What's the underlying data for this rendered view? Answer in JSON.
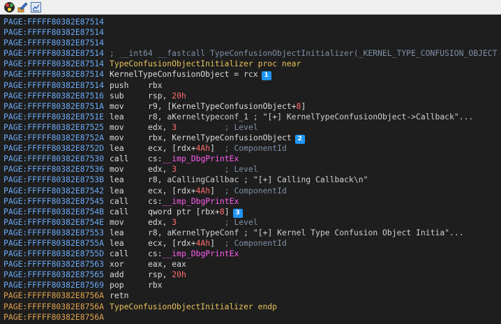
{
  "toolbar": {
    "buttons": [
      {
        "icon": "graph-view-icon",
        "label": ""
      },
      {
        "icon": "edit-icon",
        "label": ""
      },
      {
        "icon": "text-view-icon",
        "label": ""
      }
    ]
  },
  "listing": [
    {
      "address": "PAGE:FFFFF80382E87514",
      "kind": "empty"
    },
    {
      "address": "PAGE:FFFFF80382E87514",
      "kind": "empty"
    },
    {
      "address": "PAGE:FFFFF80382E87514",
      "kind": "empty"
    },
    {
      "address": "PAGE:FFFFF80382E87514",
      "kind": "comment",
      "text": "; __int64 __fastcall TypeConfusionObjectInitializer(_KERNEL_TYPE_CONFUSION_OBJECT"
    },
    {
      "address": "PAGE:FFFFF80382E87514",
      "kind": "proc",
      "text": "TypeConfusionObjectInitializer proc near"
    },
    {
      "address": "PAGE:FFFFF80382E87514",
      "kind": "assign",
      "text": "KernelTypeConfusionObject = rcx",
      "badge": "1"
    },
    {
      "address": "PAGE:FFFFF80382E87514",
      "kind": "ins",
      "mnem": "push",
      "ops": [
        {
          "t": "rbx",
          "c": "op"
        }
      ]
    },
    {
      "address": "PAGE:FFFFF80382E87516",
      "kind": "ins",
      "mnem": "sub",
      "ops": [
        {
          "t": "rsp, ",
          "c": "op"
        },
        {
          "t": "20h",
          "c": "num"
        }
      ]
    },
    {
      "address": "PAGE:FFFFF80382E8751A",
      "kind": "ins",
      "mnem": "mov",
      "ops": [
        {
          "t": "r9, [KernelTypeConfusionObject+",
          "c": "op"
        },
        {
          "t": "8",
          "c": "num"
        },
        {
          "t": "]",
          "c": "op"
        }
      ]
    },
    {
      "address": "PAGE:FFFFF80382E8751E",
      "kind": "ins",
      "mnem": "lea",
      "ops": [
        {
          "t": "r8, aKerneltypeconf_1 ; \"[+] KernelTypeConfusionObject->Callback\"...",
          "c": "str"
        }
      ]
    },
    {
      "address": "PAGE:FFFFF80382E87525",
      "kind": "ins",
      "mnem": "mov",
      "ops": [
        {
          "t": "edx, ",
          "c": "op"
        },
        {
          "t": "3",
          "c": "num"
        },
        {
          "t": "          ; Level",
          "c": "cmt"
        }
      ]
    },
    {
      "address": "PAGE:FFFFF80382E8752A",
      "kind": "ins",
      "mnem": "mov",
      "ops": [
        {
          "t": "rbx, KernelTypeConfusionObject",
          "c": "op"
        }
      ],
      "badge": "2"
    },
    {
      "address": "PAGE:FFFFF80382E8752D",
      "kind": "ins",
      "mnem": "lea",
      "ops": [
        {
          "t": "ecx, [rdx+",
          "c": "op"
        },
        {
          "t": "4Ah",
          "c": "num"
        },
        {
          "t": "]",
          "c": "op"
        },
        {
          "t": "  ; ComponentId",
          "c": "cmt"
        }
      ]
    },
    {
      "address": "PAGE:FFFFF80382E87530",
      "kind": "ins",
      "mnem": "call",
      "ops": [
        {
          "t": "cs:",
          "c": "op"
        },
        {
          "t": "__imp_DbgPrintEx",
          "c": "imp"
        }
      ]
    },
    {
      "address": "PAGE:FFFFF80382E87536",
      "kind": "ins",
      "mnem": "mov",
      "ops": [
        {
          "t": "edx, ",
          "c": "op"
        },
        {
          "t": "3",
          "c": "num"
        },
        {
          "t": "          ; Level",
          "c": "cmt"
        }
      ]
    },
    {
      "address": "PAGE:FFFFF80382E8753B",
      "kind": "ins",
      "mnem": "lea",
      "ops": [
        {
          "t": "r8, aCallingCallbac ; \"[+] Calling Callback\\n\"",
          "c": "str"
        }
      ]
    },
    {
      "address": "PAGE:FFFFF80382E87542",
      "kind": "ins",
      "mnem": "lea",
      "ops": [
        {
          "t": "ecx, [rdx+",
          "c": "op"
        },
        {
          "t": "4Ah",
          "c": "num"
        },
        {
          "t": "]",
          "c": "op"
        },
        {
          "t": "  ; ComponentId",
          "c": "cmt"
        }
      ]
    },
    {
      "address": "PAGE:FFFFF80382E87545",
      "kind": "ins",
      "mnem": "call",
      "ops": [
        {
          "t": "cs:",
          "c": "op"
        },
        {
          "t": "__imp_DbgPrintEx",
          "c": "imp"
        }
      ]
    },
    {
      "address": "PAGE:FFFFF80382E8754B",
      "kind": "ins",
      "mnem": "call",
      "ops": [
        {
          "t": "qword ptr [rbx+",
          "c": "op"
        },
        {
          "t": "8",
          "c": "num"
        },
        {
          "t": "]",
          "c": "op"
        }
      ],
      "badge": "3"
    },
    {
      "address": "PAGE:FFFFF80382E8754E",
      "kind": "ins",
      "mnem": "mov",
      "ops": [
        {
          "t": "edx, ",
          "c": "op"
        },
        {
          "t": "3",
          "c": "num"
        },
        {
          "t": "          ; Level",
          "c": "cmt"
        }
      ]
    },
    {
      "address": "PAGE:FFFFF80382E87553",
      "kind": "ins",
      "mnem": "lea",
      "ops": [
        {
          "t": "r8, aKernelTypeConf ; \"[+] Kernel Type Confusion Object Initia\"...",
          "c": "str"
        }
      ]
    },
    {
      "address": "PAGE:FFFFF80382E8755A",
      "kind": "ins",
      "mnem": "lea",
      "ops": [
        {
          "t": "ecx, [rdx+",
          "c": "op"
        },
        {
          "t": "4Ah",
          "c": "num"
        },
        {
          "t": "]",
          "c": "op"
        },
        {
          "t": "  ; ComponentId",
          "c": "cmt"
        }
      ]
    },
    {
      "address": "PAGE:FFFFF80382E8755D",
      "kind": "ins",
      "mnem": "call",
      "ops": [
        {
          "t": "cs:",
          "c": "op"
        },
        {
          "t": "__imp_DbgPrintEx",
          "c": "imp"
        }
      ]
    },
    {
      "address": "PAGE:FFFFF80382E87563",
      "kind": "ins",
      "mnem": "xor",
      "ops": [
        {
          "t": "eax, eax",
          "c": "op"
        }
      ]
    },
    {
      "address": "PAGE:FFFFF80382E87565",
      "kind": "ins",
      "mnem": "add",
      "ops": [
        {
          "t": "rsp, ",
          "c": "op"
        },
        {
          "t": "20h",
          "c": "num"
        }
      ]
    },
    {
      "address": "PAGE:FFFFF80382E87569",
      "kind": "ins",
      "mnem": "pop",
      "ops": [
        {
          "t": "rbx",
          "c": "op"
        }
      ]
    },
    {
      "address": "PAGE:FFFFF80382E8756A",
      "kind": "ins",
      "mnem": "retn",
      "ops": [],
      "hl": true
    },
    {
      "address": "PAGE:FFFFF80382E8756A",
      "kind": "proc",
      "text": "TypeConfusionObjectInitializer endp",
      "hl": true
    },
    {
      "address": "PAGE:FFFFF80382E8756A",
      "kind": "empty",
      "hl": true
    }
  ],
  "colors": {
    "background": "#1e1e1e",
    "address": "#6aa9f5",
    "address_highlight": "#e0a14c",
    "number": "#ff6b6b",
    "comment": "#7f8fa6",
    "import": "#ff5cf0",
    "procname": "#e8c25a",
    "badge": "#2196f3"
  }
}
